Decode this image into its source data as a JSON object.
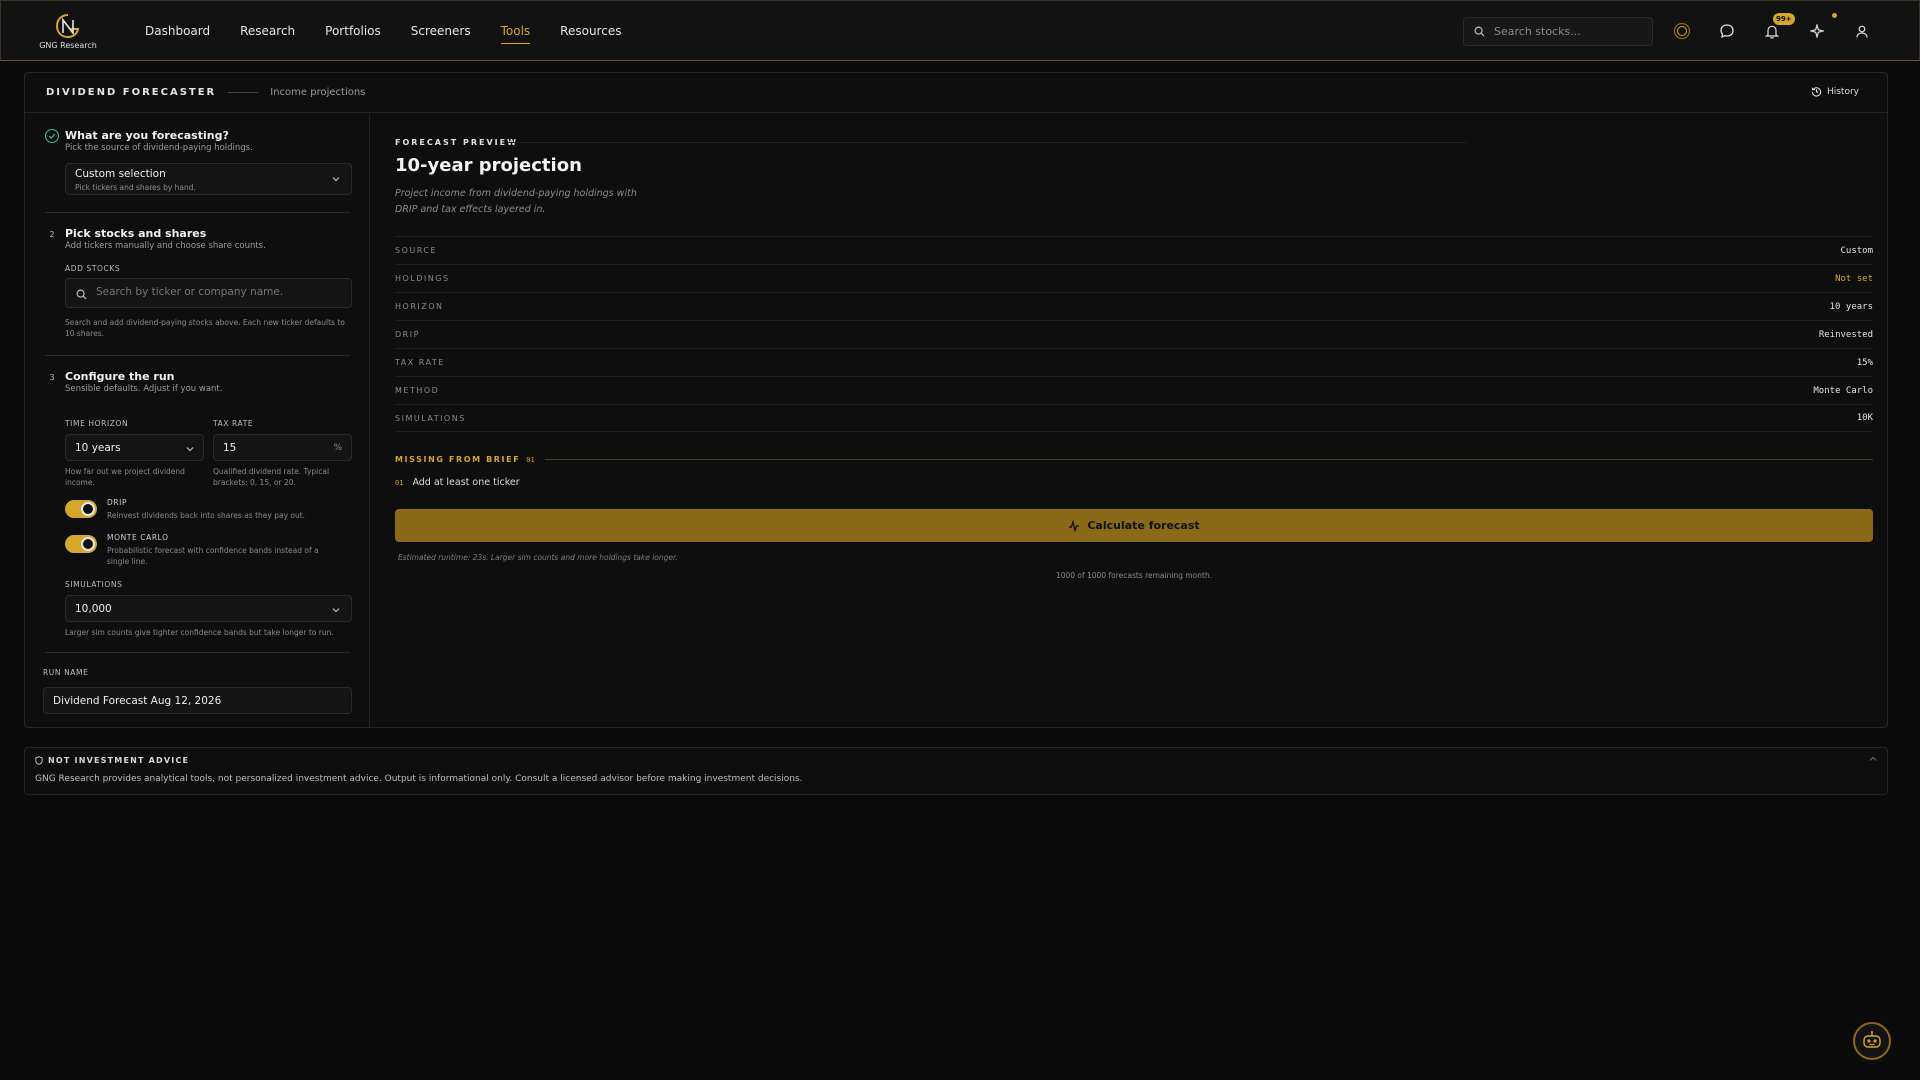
{
  "brand": {
    "name": "GNG Research"
  },
  "nav": {
    "items": [
      {
        "label": "Dashboard",
        "active": false
      },
      {
        "label": "Research",
        "active": false
      },
      {
        "label": "Portfolios",
        "active": false
      },
      {
        "label": "Screeners",
        "active": false
      },
      {
        "label": "Tools",
        "active": true
      },
      {
        "label": "Resources",
        "active": false
      }
    ],
    "search_placeholder": "Search stocks...",
    "notification_count": "99+"
  },
  "page": {
    "title": "DIVIDEND FORECASTER",
    "subtitle": "Income projections",
    "history_label": "History"
  },
  "steps": {
    "s1": {
      "title": "What are you forecasting?",
      "desc": "Pick the source of dividend-paying holdings.",
      "select_value": "Custom selection",
      "select_hint": "Pick tickers and shares by hand."
    },
    "s2": {
      "number": "2",
      "title": "Pick stocks and shares",
      "desc": "Add tickers manually and choose share counts.",
      "add_label": "ADD STOCKS",
      "search_placeholder": "Search by ticker or company name.",
      "hint": "Search and add dividend-paying stocks above. Each new ticker defaults to 10 shares."
    },
    "s3": {
      "number": "3",
      "title": "Configure the run",
      "desc": "Sensible defaults. Adjust if you want.",
      "horizon_label": "TIME HORIZON",
      "horizon_value": "10 years",
      "horizon_hint": "How far out we project dividend income.",
      "tax_label": "TAX RATE",
      "tax_value": "15",
      "tax_unit": "%",
      "tax_hint": "Qualified dividend rate. Typical brackets: 0, 15, or 20.",
      "drip_label": "DRIP",
      "drip_desc": "Reinvest dividends back into shares as they pay out.",
      "drip_on": true,
      "mc_label": "MONTE CARLO",
      "mc_desc": "Probabilistic forecast with confidence bands instead of a single line.",
      "mc_on": true,
      "sims_label": "SIMULATIONS",
      "sims_value": "10,000",
      "sims_hint": "Larger sim counts give tighter confidence bands but take longer to run."
    },
    "run": {
      "label": "RUN NAME",
      "value": "Dividend Forecast Aug 12, 2026"
    }
  },
  "preview": {
    "eyebrow": "FORECAST PREVIEW",
    "title": "10-year projection",
    "desc": "Project income from dividend-paying holdings with DRIP and tax effects layered in.",
    "rows": [
      {
        "key": "SOURCE",
        "value": "Custom",
        "warn": false
      },
      {
        "key": "HOLDINGS",
        "value": "Not set",
        "warn": true
      },
      {
        "key": "HORIZON",
        "value": "10 years",
        "warn": false
      },
      {
        "key": "DRIP",
        "value": "Reinvested",
        "warn": false
      },
      {
        "key": "TAX RATE",
        "value": "15%",
        "warn": false
      },
      {
        "key": "METHOD",
        "value": "Monte Carlo",
        "warn": false
      },
      {
        "key": "SIMULATIONS",
        "value": "10K",
        "warn": false
      }
    ],
    "missing_title": "MISSING FROM BRIEF",
    "missing_count": "01",
    "missing_items": [
      {
        "num": "01",
        "text": "Add at least one ticker"
      }
    ],
    "calc_label": "Calculate forecast",
    "runtime": "Estimated runtime: 23s. Larger sim counts and more holdings take longer.",
    "remaining": "1000 of 1000 forecasts remaining month."
  },
  "disclaimer": {
    "title": "NOT INVESTMENT ADVICE",
    "text": "GNG Research provides analytical tools, not personalized investment advice. Output is informational only. Consult a licensed advisor before making investment decisions."
  },
  "colors": {
    "accent": "#d4a62a",
    "button": "#8a6a18",
    "background": "#0b0b0b",
    "success": "#3fbf8a"
  }
}
